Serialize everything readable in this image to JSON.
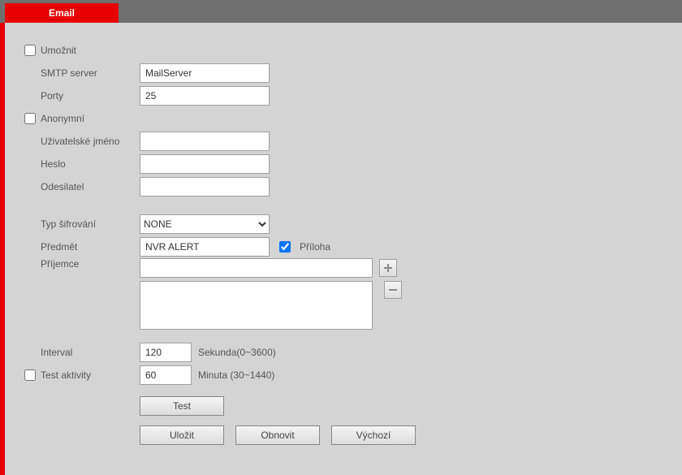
{
  "tab": {
    "label": "Email"
  },
  "fields": {
    "enable_label": "Umožnit",
    "smtp_label": "SMTP server",
    "smtp_value": "MailServer",
    "port_label": "Porty",
    "port_value": "25",
    "anon_label": "Anonymní",
    "user_label": "Uživatelské jméno",
    "user_value": "",
    "pass_label": "Heslo",
    "pass_value": "",
    "sender_label": "Odesilatel",
    "sender_value": "",
    "enc_label": "Typ šifrování",
    "enc_value": "NONE",
    "subject_label": "Předmět",
    "subject_value": "NVR ALERT",
    "attach_label": "Příloha",
    "recipient_label": "Příjemce",
    "recipient_value": "",
    "recipient_list": "",
    "interval_label": "Interval",
    "interval_value": "120",
    "interval_unit": "Sekunda(0~3600)",
    "health_label": "Test aktivity",
    "health_value": "60",
    "health_unit": "Minuta (30~1440)"
  },
  "buttons": {
    "test": "Test",
    "save": "Uložit",
    "refresh": "Obnovit",
    "default": "Výchozí"
  }
}
